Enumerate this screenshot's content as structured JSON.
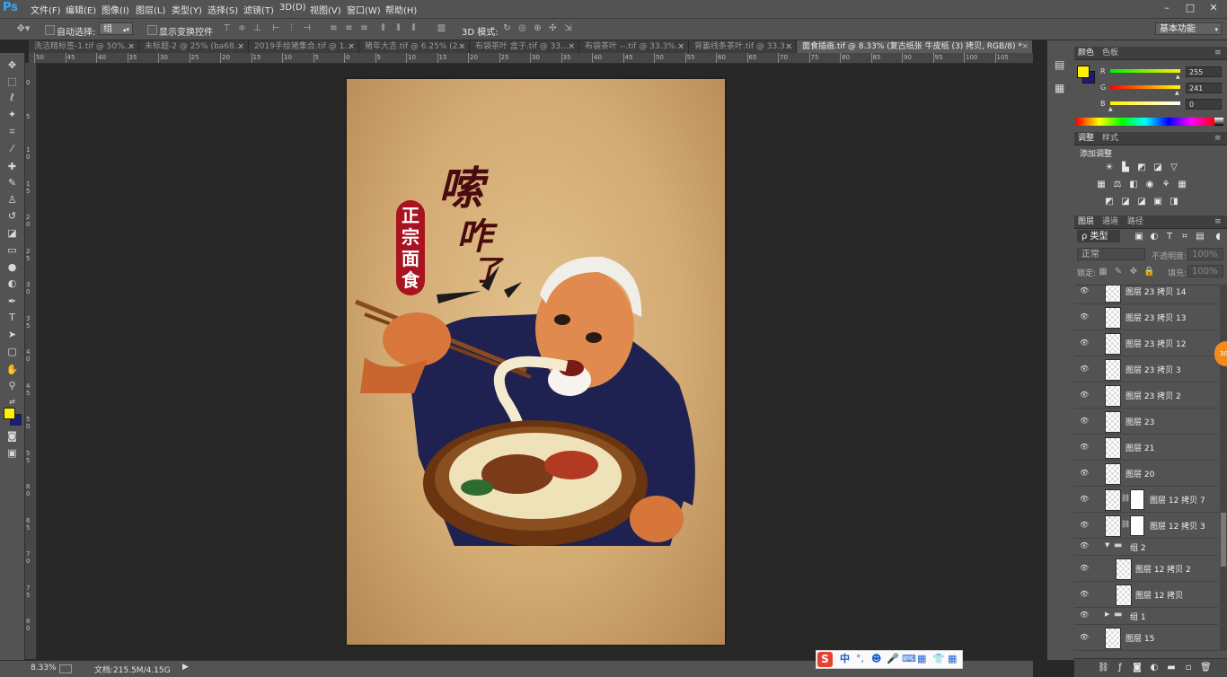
{
  "app": {
    "logo": "Ps"
  },
  "menu": [
    "文件(F)",
    "编辑(E)",
    "图像(I)",
    "图层(L)",
    "类型(Y)",
    "选择(S)",
    "滤镜(T)",
    "3D(D)",
    "视图(V)",
    "窗口(W)",
    "帮助(H)"
  ],
  "window_controls": {
    "minimize": "–",
    "maximize": "□",
    "close": "✕"
  },
  "options": {
    "auto_select_label": "自动选择:",
    "auto_select_value": "组",
    "show_transform_label": "显示变换控件",
    "mode_3d_label": "3D 模式:",
    "workspace": "基本功能"
  },
  "tabs": [
    {
      "label": "洗洁精标签-1.tif @ 50%..."
    },
    {
      "label": "未标题-2 @ 25% (ba68..."
    },
    {
      "label": "2019手绘猪集合.tif @ 1..."
    },
    {
      "label": "猪年大吉.tif @ 6.25% (2..."
    },
    {
      "label": "布袋茶叶 盒子.tif @ 33...."
    },
    {
      "label": "布袋茶叶 --.tif @ 33.3%..."
    },
    {
      "label": "背篓线条茶叶.tif @ 33.3..."
    },
    {
      "label": "面食插画.tif @ 8.33% (复古纸张 牛皮纸 (3) 拷贝, RGB/8) *"
    }
  ],
  "tab_close": "×",
  "ruler": {
    "h_ticks": [
      "50",
      "45",
      "40",
      "35",
      "30",
      "25",
      "20",
      "15",
      "10",
      "5",
      "0",
      "5",
      "10",
      "15",
      "20",
      "25",
      "30",
      "35",
      "40",
      "45",
      "50",
      "55",
      "60",
      "65",
      "70",
      "75",
      "80",
      "85",
      "90",
      "95",
      "100",
      "105"
    ],
    "v_ticks": [
      "0",
      "5",
      "1 0",
      "1 5",
      "2 0",
      "2 5",
      "3 0",
      "3 5",
      "4 0",
      "4 5",
      "5 0",
      "5 5",
      "6 0",
      "6 5",
      "7 0",
      "7 5",
      "8 0"
    ]
  },
  "artwork": {
    "seal_chars": [
      "正",
      "宗",
      "面",
      "食"
    ],
    "headline": [
      "嗦",
      "咋",
      "了"
    ]
  },
  "status": {
    "zoom": "8.33%",
    "doc_info": "文档:215.5M/4.15G"
  },
  "color_panel": {
    "tabs": [
      "颜色",
      "色板"
    ],
    "channels": [
      {
        "label": "R",
        "value": "255"
      },
      {
        "label": "G",
        "value": "241"
      },
      {
        "label": "B",
        "value": "0"
      }
    ],
    "fg_color": "#fff100",
    "bg_color": "#1b1d7e"
  },
  "adjust_panel": {
    "tabs": [
      "调整",
      "样式"
    ],
    "title": "添加调整"
  },
  "layers_panel": {
    "tabs": [
      "图层",
      "通道",
      "路径"
    ],
    "filter": "ρ 类型",
    "blend_mode": "正常",
    "opacity_label": "不透明度:",
    "opacity_value": "100%",
    "lock_label": "锁定:",
    "fill_label": "填充:",
    "fill_value": "100%",
    "layers": [
      {
        "name": "图层 23 拷贝 14",
        "type": "layer"
      },
      {
        "name": "图层 23 拷贝 13",
        "type": "layer"
      },
      {
        "name": "图层 23 拷贝 12",
        "type": "layer"
      },
      {
        "name": "图层 23 拷贝 3",
        "type": "layer"
      },
      {
        "name": "图层 23 拷贝 2",
        "type": "layer"
      },
      {
        "name": "图层 23",
        "type": "layer"
      },
      {
        "name": "图层 21",
        "type": "layer"
      },
      {
        "name": "图层 20",
        "type": "layer"
      },
      {
        "name": "图层 12 拷贝 7",
        "type": "masked"
      },
      {
        "name": "图层 12 拷贝 3",
        "type": "masked"
      },
      {
        "name": "组 2",
        "type": "group-open"
      },
      {
        "name": "图层 12 拷贝 2",
        "type": "child"
      },
      {
        "name": "图层 12 拷贝",
        "type": "child"
      },
      {
        "name": "组 1",
        "type": "group-closed"
      },
      {
        "name": "图层 15",
        "type": "layer"
      }
    ]
  },
  "ime": {
    "logo": "S",
    "mode": "中"
  }
}
